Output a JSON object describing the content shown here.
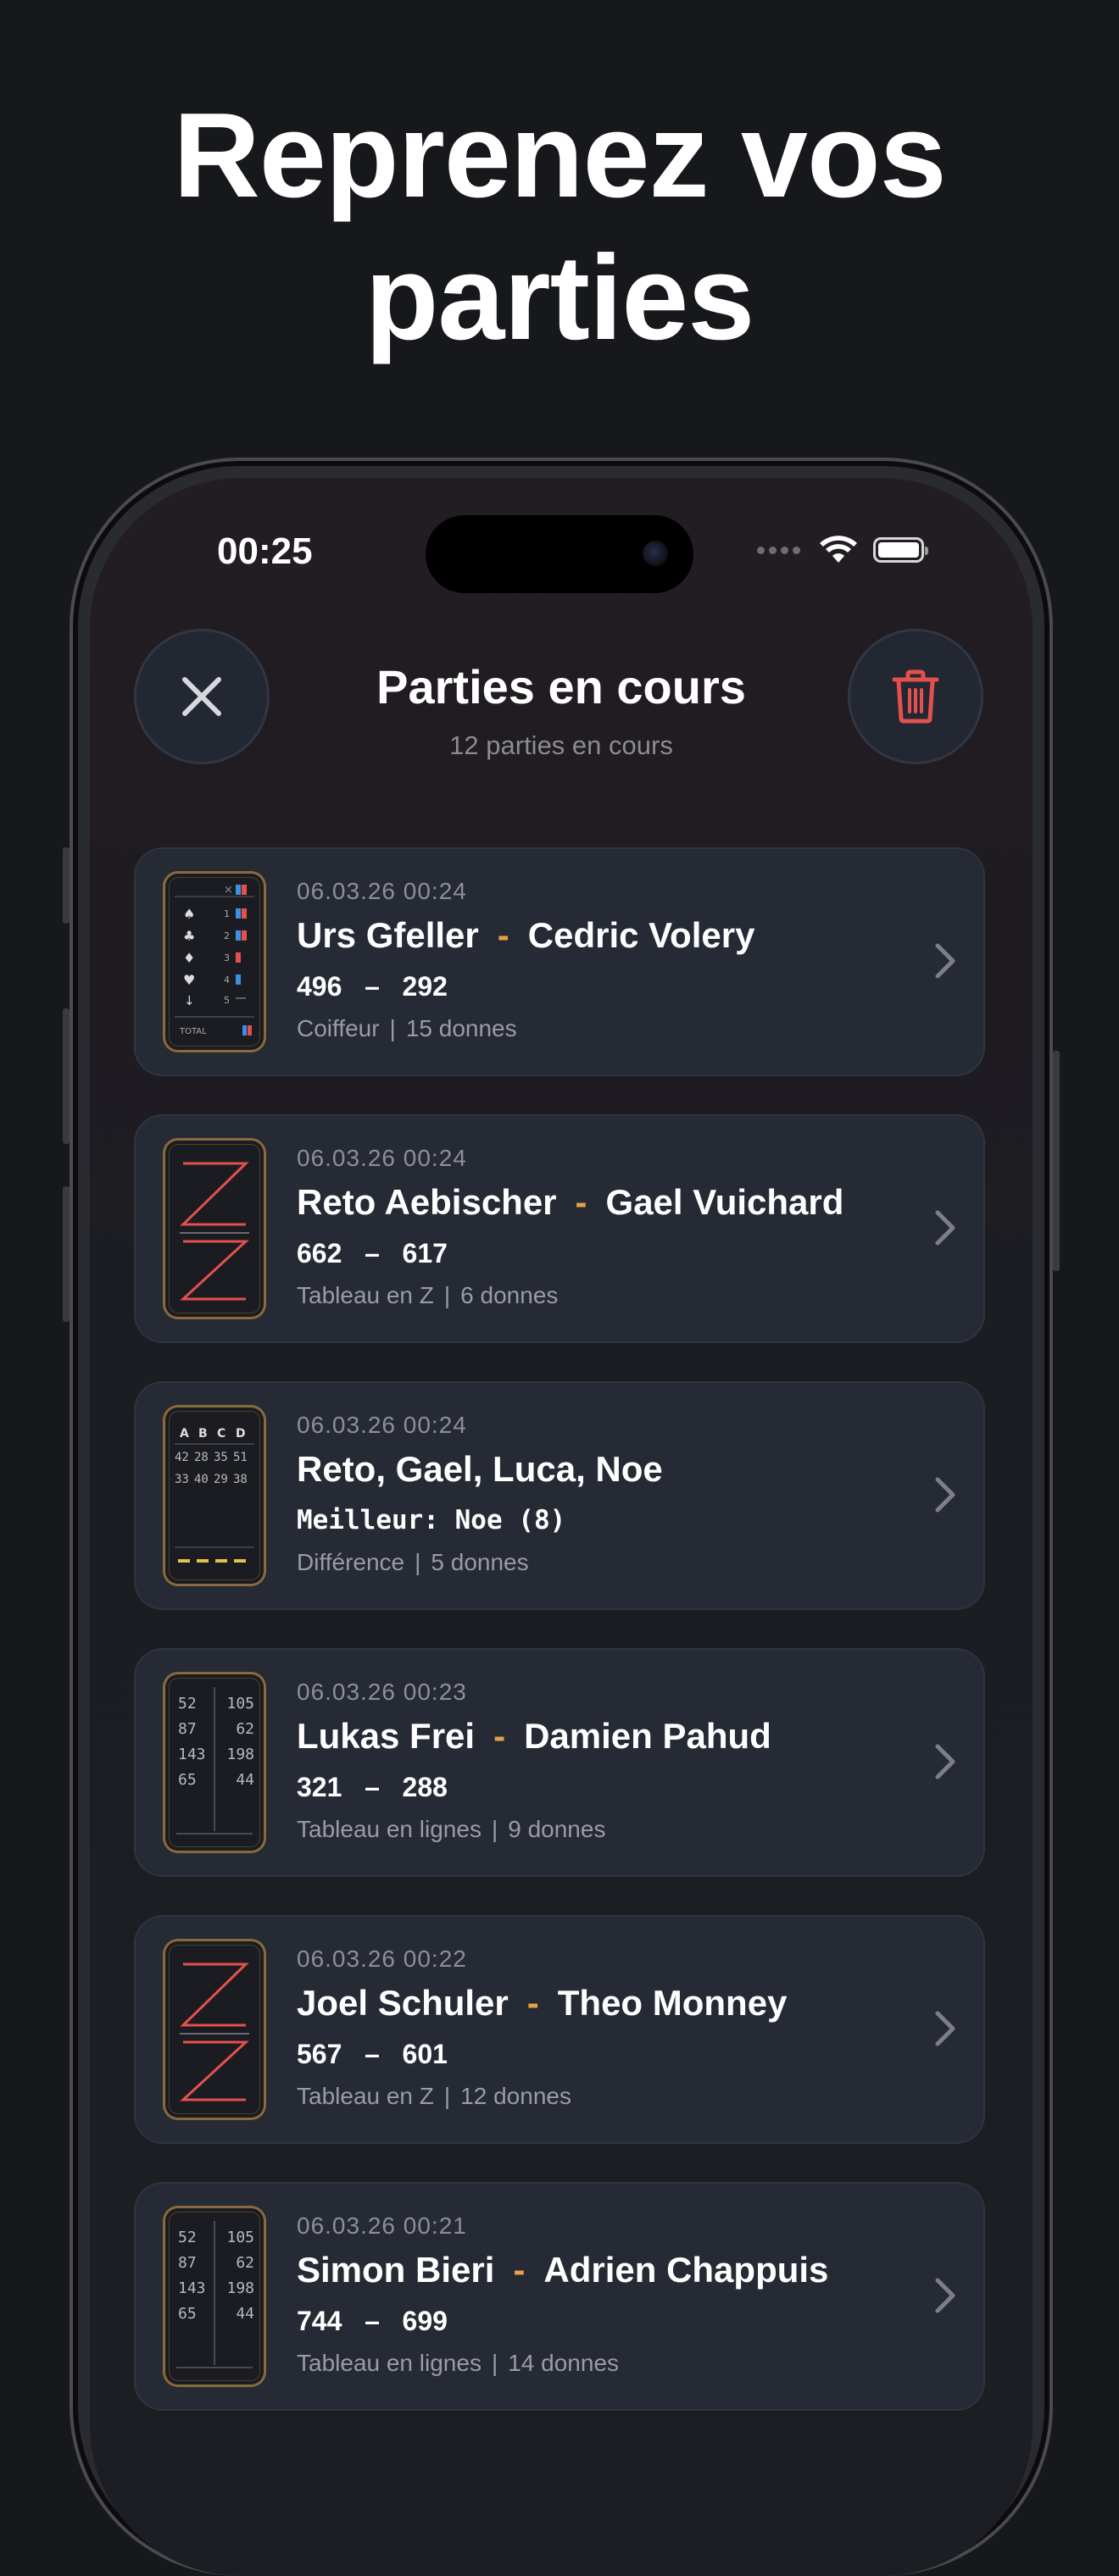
{
  "headline": {
    "line1": "Reprenez vos",
    "line2": "parties"
  },
  "status_bar": {
    "time": "00:25"
  },
  "header": {
    "title": "Parties en cours",
    "subtitle": "12 parties en cours"
  },
  "colors": {
    "accent_dash": "#e2a24a",
    "delete_red": "#e2514d",
    "card_bg": "#262a35"
  },
  "games": [
    {
      "date": "06.03.26 00:24",
      "player1": "Urs Gfeller",
      "player2": "Cedric Volery",
      "score1": "496",
      "score2": "292",
      "mode": "Coiffeur",
      "rounds": "15 donnes",
      "thumb": "coiffeur"
    },
    {
      "date": "06.03.26 00:24",
      "player1": "Reto Aebischer",
      "player2": "Gael Vuichard",
      "score1": "662",
      "score2": "617",
      "mode": "Tableau en Z",
      "rounds": "6 donnes",
      "thumb": "z"
    },
    {
      "date": "06.03.26 00:24",
      "players": "Reto, Gael, Luca, Noe",
      "best": "Meilleur: Noe (8)",
      "mode": "Différence",
      "rounds": "5 donnes",
      "thumb": "diff"
    },
    {
      "date": "06.03.26 00:23",
      "player1": "Lukas Frei",
      "player2": "Damien Pahud",
      "score1": "321",
      "score2": "288",
      "mode": "Tableau en lignes",
      "rounds": "9 donnes",
      "thumb": "lines"
    },
    {
      "date": "06.03.26 00:22",
      "player1": "Joel Schuler",
      "player2": "Theo Monney",
      "score1": "567",
      "score2": "601",
      "mode": "Tableau en Z",
      "rounds": "12 donnes",
      "thumb": "z"
    },
    {
      "date": "06.03.26 00:21",
      "player1": "Simon Bieri",
      "player2": "Adrien Chappuis",
      "score1": "744",
      "score2": "699",
      "mode": "Tableau en lignes",
      "rounds": "14 donnes",
      "thumb": "lines"
    }
  ],
  "thumbs": {
    "coiffeur_rows": [
      "1",
      "2",
      "3",
      "4",
      "5"
    ],
    "coiffeur_total": "TOTAL",
    "diff_header": [
      "A",
      "B",
      "C",
      "D"
    ],
    "diff_row1": [
      "42",
      "28",
      "35",
      "51"
    ],
    "diff_row2": [
      "33",
      "40",
      "29",
      "38"
    ],
    "lines_rows": [
      [
        "52",
        "105"
      ],
      [
        "87",
        "62"
      ],
      [
        "143",
        "198"
      ],
      [
        "65",
        "44"
      ]
    ]
  }
}
